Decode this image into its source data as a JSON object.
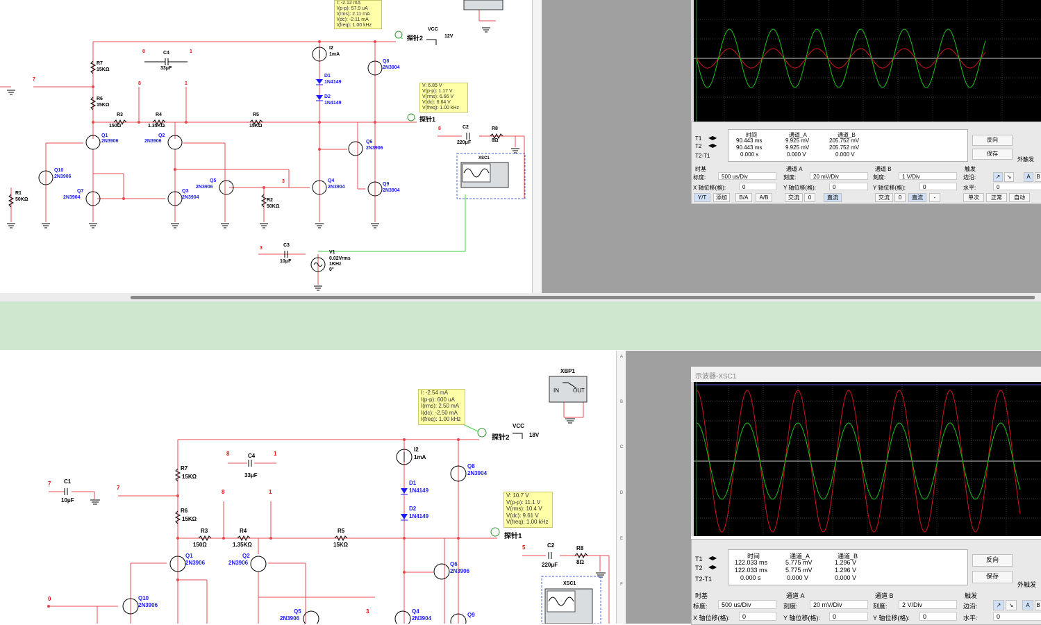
{
  "top": {
    "probe2": {
      "title": "探针2",
      "lines": [
        "I: -2.12 mA",
        "I(p-p): 57.9 uA",
        "I(rms): 2.11 mA",
        "I(dc): -2.11 mA",
        "I(freq): 1.00 kHz"
      ]
    },
    "probe1": {
      "title": "探针1",
      "lines": [
        "V: 6.85 V",
        "V(p-p): 1.17 V",
        "V(rms): 6.66 V",
        "V(dc): 6.64 V",
        "V(freq): 1.00 kHz"
      ]
    },
    "vcc": {
      "name": "VCC",
      "value": "12V"
    },
    "comps": {
      "r7": [
        "R7",
        "15KΩ"
      ],
      "r6": [
        "R6",
        "15KΩ"
      ],
      "r3": [
        "R3",
        "150Ω"
      ],
      "r4": [
        "R4",
        "1.35KΩ"
      ],
      "r5": [
        "R5",
        "15KΩ"
      ],
      "r1": [
        "R1",
        "50KΩ"
      ],
      "r2": [
        "R2",
        "50KΩ"
      ],
      "r8": [
        "R8",
        "8Ω"
      ],
      "c4": [
        "C4",
        "33μF"
      ],
      "c3": [
        "C3",
        "10μF"
      ],
      "c2": [
        "C2",
        "220μF"
      ],
      "q1": [
        "Q1",
        "2N3906"
      ],
      "q2": [
        "Q2",
        "2N3906"
      ],
      "q3": [
        "Q3",
        "2N3904"
      ],
      "q4": [
        "Q4",
        "2N3904"
      ],
      "q5": [
        "Q5",
        "2N3906"
      ],
      "q6": [
        "Q6",
        "2N3906"
      ],
      "q7": [
        "Q7",
        "2N3904"
      ],
      "q8": [
        "Q8",
        "2N3904"
      ],
      "q9": [
        "Q9",
        "2N3904"
      ],
      "q10": [
        "Q10",
        "2N3906"
      ],
      "d1": [
        "D1",
        "1N4149"
      ],
      "d2": [
        "D2",
        "1N4149"
      ],
      "i2": [
        "I2",
        "1mA"
      ],
      "v1": [
        "V1",
        "0.02Vrms",
        "1KHz",
        "0°"
      ],
      "xsc": "XSC1"
    },
    "nodes": {
      "n8a": "8",
      "n1a": "1",
      "n7": "7",
      "n8b": "8",
      "n1b": "1",
      "n3": "3",
      "n3b": "3",
      "n8c": "8"
    },
    "osc": {
      "t1": "T1",
      "t2": "T2",
      "t2t1": "T2-T1",
      "cols": [
        "时间",
        "通道_A",
        "通道_B"
      ],
      "rows": [
        [
          "90.443 ms",
          "9.925 mV",
          "205.752 mV"
        ],
        [
          "90.443 ms",
          "9.925 mV",
          "205.752 mV"
        ],
        [
          "0.000 s",
          "0.000 V",
          "0.000 V"
        ]
      ],
      "reverse": "反向",
      "save": "保存",
      "ext": "外触发",
      "timebase": {
        "title": "时基",
        "scale_label": "标度:",
        "scale": "500 us/Div",
        "xpos_label": "X 轴位移(格):",
        "xpos": "0"
      },
      "chA": {
        "title": "通道 A",
        "scale_label": "刻度:",
        "scale": "20 mV/Div",
        "ypos_label": "Y 轴位移(格):",
        "ypos": "0"
      },
      "chB": {
        "title": "通道 B",
        "scale_label": "刻度:",
        "scale": "1 V/Div",
        "ypos_label": "Y 轴位移(格):",
        "ypos": "0"
      },
      "trig": {
        "title": "触发",
        "edge_label": "边沿:",
        "level_label": "水平:",
        "level": "0"
      },
      "btns": [
        "Y/T",
        "添加",
        "B/A",
        "A/B"
      ],
      "coupA": [
        "交流",
        "0",
        "直流"
      ],
      "coupB": [
        "交流",
        "0",
        "直流",
        "-"
      ],
      "trigBtns": [
        "单次",
        "正常",
        "自动"
      ],
      "ab": [
        "A",
        "B"
      ]
    }
  },
  "bottom": {
    "probe2": {
      "title": "探针2",
      "lines": [
        "I: -2.54 mA",
        "I(p-p): 600 uA",
        "I(rms): 2.50 mA",
        "I(dc): -2.50 mA",
        "I(freq): 1.00 kHz"
      ]
    },
    "probe1": {
      "title": "探针1",
      "lines": [
        "V: 10.7 V",
        "V(p-p): 11.1 V",
        "V(rms): 10.4 V",
        "V(dc): 9.61 V",
        "V(freq): 1.00 kHz"
      ]
    },
    "vcc": {
      "name": "VCC",
      "value": "18V"
    },
    "comps": {
      "r7": [
        "R7",
        "15KΩ"
      ],
      "r6": [
        "R6",
        "15KΩ"
      ],
      "r3": [
        "R3",
        "150Ω"
      ],
      "r4": [
        "R4",
        "1.35KΩ"
      ],
      "r5": [
        "R5",
        "15KΩ"
      ],
      "r8": [
        "R8",
        "8Ω"
      ],
      "c1": [
        "C1",
        "10μF"
      ],
      "c4": [
        "C4",
        "33μF"
      ],
      "c2": [
        "C2",
        "220μF"
      ],
      "q1": [
        "Q1",
        "2N3906"
      ],
      "q2": [
        "Q2",
        "2N3906"
      ],
      "q4": [
        "Q4",
        "2N3904"
      ],
      "q5": [
        "Q5",
        "2N3906"
      ],
      "q6": [
        "Q6",
        "2N3906"
      ],
      "q8": [
        "Q8",
        "2N3904"
      ],
      "q9": [
        "Q9",
        "2N3904"
      ],
      "q10": [
        "Q10",
        "2N3906"
      ],
      "d1": [
        "D1",
        "1N4149"
      ],
      "d2": [
        "D2",
        "1N4149"
      ],
      "i2": [
        "I2",
        "1mA"
      ],
      "xbp": "XBP1",
      "xbp_in": "IN",
      "xbp_out": "OUT",
      "xsc": "XSC1"
    },
    "nodes": {
      "n7a": "7",
      "n7b": "7",
      "n8a": "8",
      "n1a": "1",
      "n8b": "8",
      "n1b": "1",
      "n0": "0",
      "n5": "5",
      "n3": "3"
    },
    "ruler": [
      "A",
      "B",
      "C",
      "D",
      "E",
      "F"
    ],
    "osc": {
      "title": "示波器-XSC1",
      "t1": "T1",
      "t2": "T2",
      "t2t1": "T2-T1",
      "cols": [
        "时间",
        "通道_A",
        "通道_B"
      ],
      "rows": [
        [
          "122.033 ms",
          "5.775 mV",
          "1.296 V"
        ],
        [
          "122.033 ms",
          "5.775 mV",
          "1.296 V"
        ],
        [
          "0.000 s",
          "0.000 V",
          "0.000 V"
        ]
      ],
      "reverse": "反向",
      "save": "保存",
      "ext": "外触发",
      "timebase": {
        "title": "时基",
        "scale_label": "标度:",
        "scale": "500 us/Div",
        "xpos_label": "X 轴位移(格):",
        "xpos": "0"
      },
      "chA": {
        "title": "通道 A",
        "scale_label": "刻度:",
        "scale": "20 mV/Div",
        "ypos_label": "Y 轴位移(格):",
        "ypos": "0"
      },
      "chB": {
        "title": "通道 B",
        "scale_label": "刻度:",
        "scale": "2 V/Div",
        "ypos_label": "Y 轴位移(格):",
        "ypos": "0"
      },
      "trig": {
        "title": "触发",
        "edge_label": "边沿:",
        "level_label": "水平:",
        "level": "0"
      },
      "ab": [
        "A",
        "B"
      ]
    }
  },
  "colors": {
    "wire": "#e8494e",
    "label_blue": "#1a1aff",
    "probe_bg": "#ffffa8",
    "trace_green": "#19c219",
    "trace_red": "#d0141e",
    "separator": "#cfe6cf",
    "node_red": "#e81010"
  }
}
